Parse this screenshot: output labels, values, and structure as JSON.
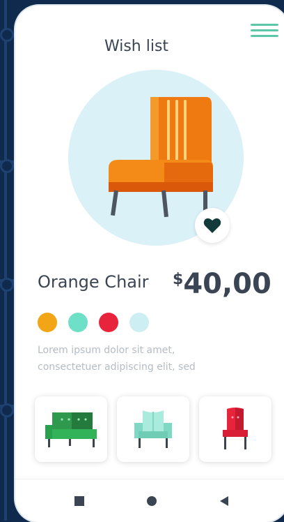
{
  "screen": {
    "title": "Wish list"
  },
  "product": {
    "name": "Orange Chair",
    "currency": "$",
    "price": "40,00",
    "description_line1": "Lorem ipsum dolor sit amet,",
    "description_line2": "consectetuer adipiscing elit, sed"
  },
  "swatches": [
    {
      "name": "orange",
      "color": "#f2a516"
    },
    {
      "name": "mint",
      "color": "#6fe0c8"
    },
    {
      "name": "red",
      "color": "#e8233c"
    },
    {
      "name": "light-blue",
      "color": "#cdeff4"
    }
  ],
  "thumbnails": [
    {
      "name": "green-sofa",
      "icon": "green-sofa-icon"
    },
    {
      "name": "mint-armchair",
      "icon": "mint-armchair-icon"
    },
    {
      "name": "red-chair",
      "icon": "red-chair-icon"
    }
  ],
  "nav": {
    "items": [
      "square-icon",
      "circle-icon",
      "back-triangle-icon"
    ]
  },
  "colors": {
    "accent": "#5cc7a7",
    "background": "#0f2a4d",
    "hero_circle": "#d9f1f7"
  }
}
